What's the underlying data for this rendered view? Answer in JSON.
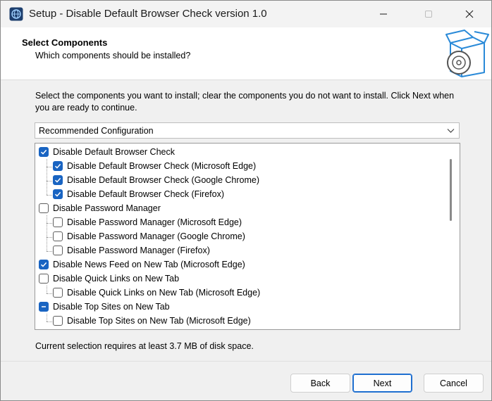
{
  "window": {
    "title": "Setup - Disable Default Browser Check version 1.0"
  },
  "header": {
    "title": "Select Components",
    "subtitle": "Which components should be installed?"
  },
  "description": "Select the components you want to install; clear the components you do not want to install. Click Next when you are ready to continue.",
  "combo": {
    "selected": "Recommended Configuration"
  },
  "components": [
    {
      "label": "Disable Default Browser Check",
      "level": 0,
      "state": "checked"
    },
    {
      "label": "Disable Default Browser Check (Microsoft Edge)",
      "level": 1,
      "state": "checked"
    },
    {
      "label": "Disable Default Browser Check (Google Chrome)",
      "level": 1,
      "state": "checked"
    },
    {
      "label": "Disable Default Browser Check (Firefox)",
      "level": 1,
      "state": "checked"
    },
    {
      "label": "Disable Password Manager",
      "level": 0,
      "state": "unchecked"
    },
    {
      "label": "Disable Password Manager (Microsoft Edge)",
      "level": 1,
      "state": "unchecked"
    },
    {
      "label": "Disable Password Manager (Google Chrome)",
      "level": 1,
      "state": "unchecked"
    },
    {
      "label": "Disable Password Manager (Firefox)",
      "level": 1,
      "state": "unchecked"
    },
    {
      "label": "Disable News Feed on New Tab (Microsoft Edge)",
      "level": 0,
      "state": "checked"
    },
    {
      "label": "Disable Quick Links on New Tab",
      "level": 0,
      "state": "unchecked"
    },
    {
      "label": "Disable Quick Links on New Tab (Microsoft Edge)",
      "level": 1,
      "state": "unchecked"
    },
    {
      "label": "Disable Top Sites on New Tab",
      "level": 0,
      "state": "indeterminate"
    },
    {
      "label": "Disable Top Sites on New Tab (Microsoft Edge)",
      "level": 1,
      "state": "unchecked"
    }
  ],
  "disk_space": "Current selection requires at least 3.7 MB of disk space.",
  "buttons": {
    "back": "Back",
    "next": "Next",
    "cancel": "Cancel"
  },
  "colors": {
    "accent": "#1964c2",
    "window_bg": "#f0f0f0",
    "header_bg": "#ffffff"
  }
}
